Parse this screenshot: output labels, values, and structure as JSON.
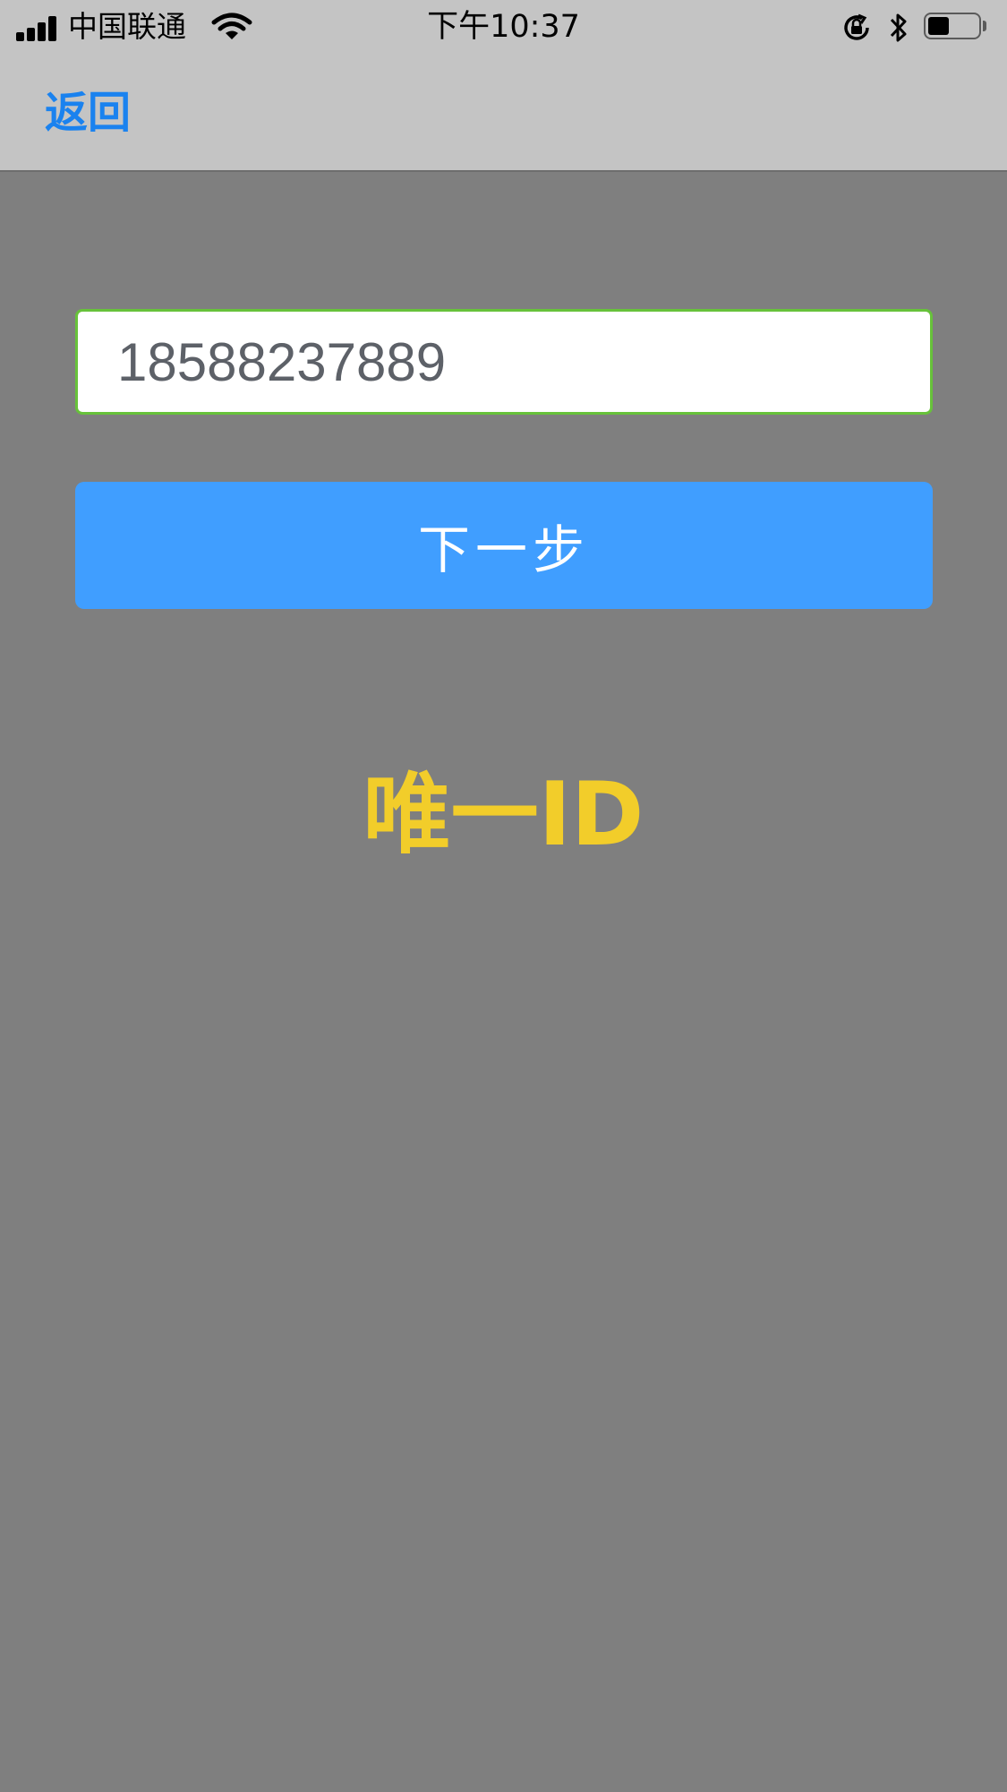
{
  "status_bar": {
    "carrier": "中国联通",
    "time": "下午10:37",
    "signal_icon": "signal-bars-icon",
    "wifi_icon": "wifi-icon",
    "lock_icon": "orientation-lock-icon",
    "bluetooth_icon": "bluetooth-icon",
    "battery_icon": "battery-icon",
    "battery_level": 0.45
  },
  "nav": {
    "back_label": "返回"
  },
  "form": {
    "phone_value": "18588237889",
    "next_label": "下一步"
  },
  "main": {
    "title": "唯一ID"
  },
  "colors": {
    "back_link": "#1a82ef",
    "input_border": "#67c23a",
    "button": "#409eff",
    "title": "#f2cd2a",
    "background": "#7f7f7f",
    "bar": "#c4c4c4"
  }
}
